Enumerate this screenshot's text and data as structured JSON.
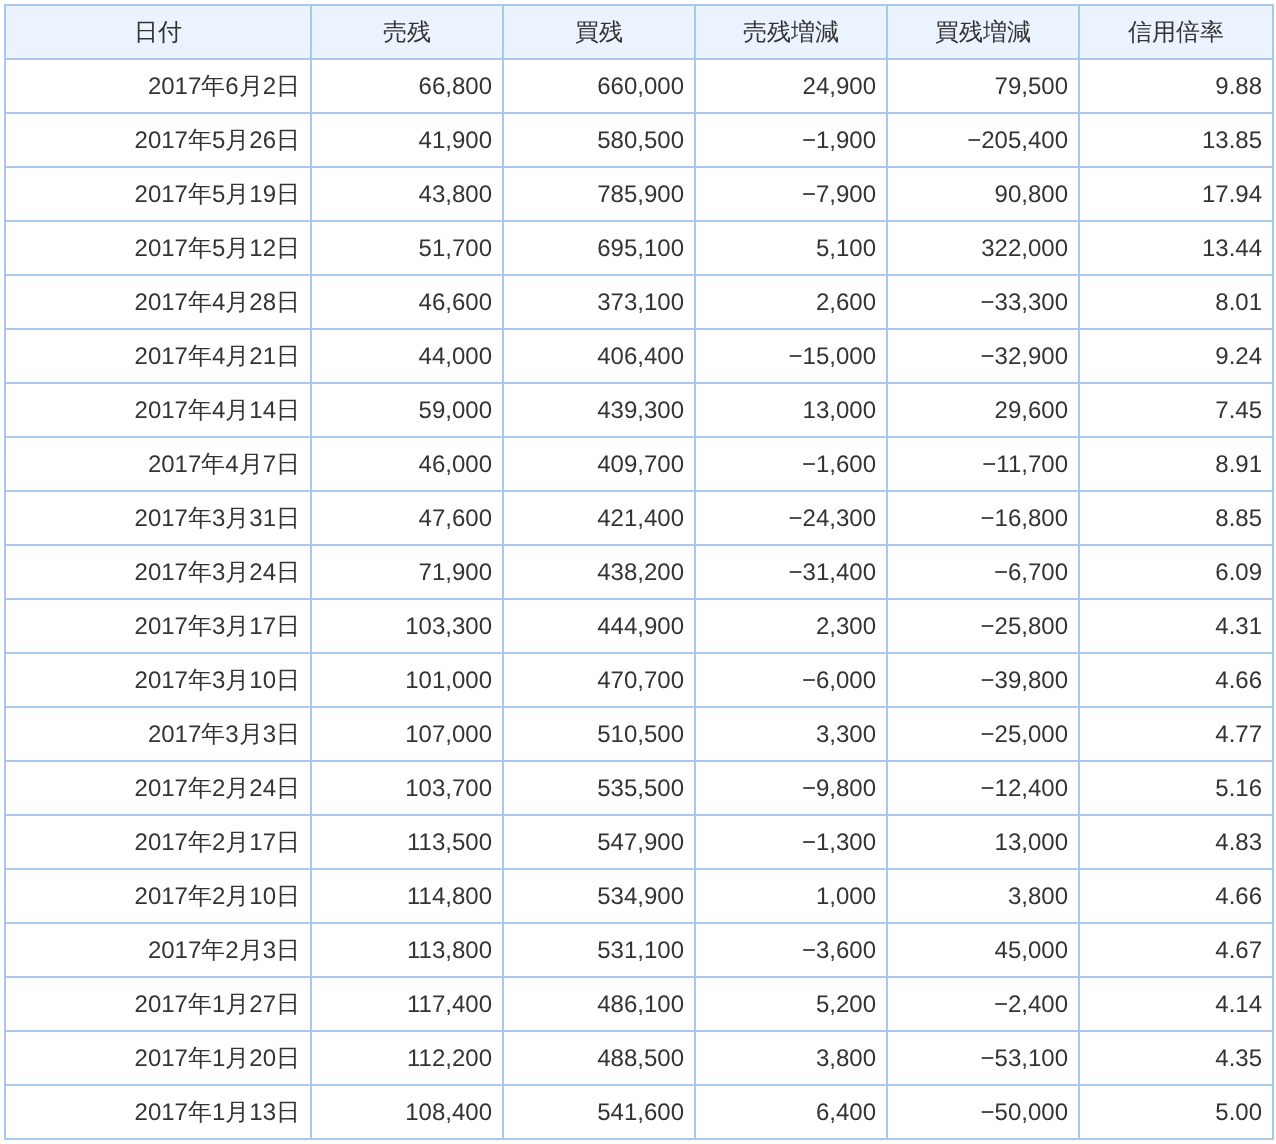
{
  "table": {
    "columns": [
      "日付",
      "売残",
      "買残",
      "売残増減",
      "買残増減",
      "信用倍率"
    ],
    "rows": [
      [
        "2017年6月2日",
        "66,800",
        "660,000",
        "24,900",
        "79,500",
        "9.88"
      ],
      [
        "2017年5月26日",
        "41,900",
        "580,500",
        "−1,900",
        "−205,400",
        "13.85"
      ],
      [
        "2017年5月19日",
        "43,800",
        "785,900",
        "−7,900",
        "90,800",
        "17.94"
      ],
      [
        "2017年5月12日",
        "51,700",
        "695,100",
        "5,100",
        "322,000",
        "13.44"
      ],
      [
        "2017年4月28日",
        "46,600",
        "373,100",
        "2,600",
        "−33,300",
        "8.01"
      ],
      [
        "2017年4月21日",
        "44,000",
        "406,400",
        "−15,000",
        "−32,900",
        "9.24"
      ],
      [
        "2017年4月14日",
        "59,000",
        "439,300",
        "13,000",
        "29,600",
        "7.45"
      ],
      [
        "2017年4月7日",
        "46,000",
        "409,700",
        "−1,600",
        "−11,700",
        "8.91"
      ],
      [
        "2017年3月31日",
        "47,600",
        "421,400",
        "−24,300",
        "−16,800",
        "8.85"
      ],
      [
        "2017年3月24日",
        "71,900",
        "438,200",
        "−31,400",
        "−6,700",
        "6.09"
      ],
      [
        "2017年3月17日",
        "103,300",
        "444,900",
        "2,300",
        "−25,800",
        "4.31"
      ],
      [
        "2017年3月10日",
        "101,000",
        "470,700",
        "−6,000",
        "−39,800",
        "4.66"
      ],
      [
        "2017年3月3日",
        "107,000",
        "510,500",
        "3,300",
        "−25,000",
        "4.77"
      ],
      [
        "2017年2月24日",
        "103,700",
        "535,500",
        "−9,800",
        "−12,400",
        "5.16"
      ],
      [
        "2017年2月17日",
        "113,500",
        "547,900",
        "−1,300",
        "13,000",
        "4.83"
      ],
      [
        "2017年2月10日",
        "114,800",
        "534,900",
        "1,000",
        "3,800",
        "4.66"
      ],
      [
        "2017年2月3日",
        "113,800",
        "531,100",
        "−3,600",
        "45,000",
        "4.67"
      ],
      [
        "2017年1月27日",
        "117,400",
        "486,100",
        "5,200",
        "−2,400",
        "4.14"
      ],
      [
        "2017年1月20日",
        "112,200",
        "488,500",
        "3,800",
        "−53,100",
        "4.35"
      ],
      [
        "2017年1月13日",
        "108,400",
        "541,600",
        "6,400",
        "−50,000",
        "5.00"
      ]
    ]
  }
}
